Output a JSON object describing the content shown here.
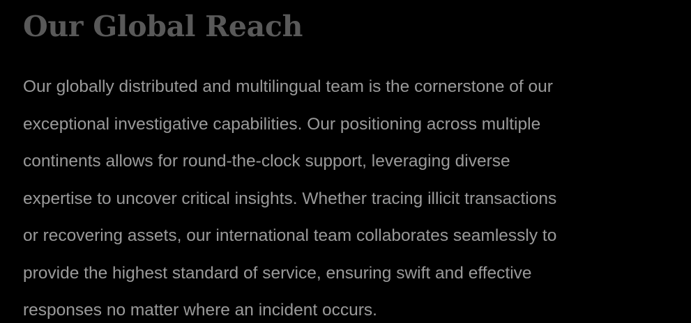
{
  "section": {
    "title": "Our Global Reach",
    "paragraph_lines": [
      "Our globally distributed and multilingual team is the cornerstone of our",
      "exceptional investigative capabilities. Our positioning across multiple",
      "continents allows for round-the-clock support, leveraging diverse",
      "expertise to uncover critical insights. Whether tracing illicit transactions",
      "or recovering assets, our international team collaborates seamlessly to",
      "provide the highest standard of service, ensuring swift and effective",
      "responses no matter where an incident occurs."
    ]
  },
  "colors": {
    "background": "#000000",
    "heading": "#595959",
    "body_text": "#9a9a9a"
  }
}
